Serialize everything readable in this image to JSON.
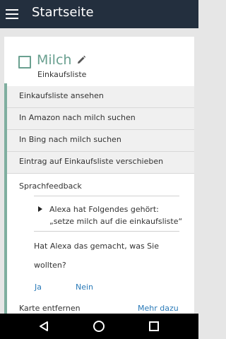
{
  "appbar": {
    "title": "Startseite",
    "menu_icon": "hamburger-icon"
  },
  "card": {
    "title": "Milch",
    "subtitle": "Einkaufsliste",
    "actions": [
      "Einkaufsliste ansehen",
      "In Amazon nach milch suchen",
      "In Bing nach milch suchen",
      "Eintrag auf Einkaufsliste verschieben"
    ],
    "feedback": {
      "label": "Sprachfeedback",
      "heard_line1": "Alexa hat Folgendes gehört:",
      "heard_line2": "„setze milch auf die einkaufsliste“",
      "question": "Hat Alexa das gemacht, was Sie wollten?",
      "yes": "Ja",
      "no": "Nein"
    },
    "remove": "Karte entfernen",
    "more": "Mehr dazu"
  },
  "colors": {
    "appbar": "#232f3e",
    "accent": "#7fae9f",
    "link": "#2a7ab8"
  },
  "navbar": {
    "icons": [
      "back-icon",
      "home-icon",
      "recent-apps-icon"
    ]
  }
}
